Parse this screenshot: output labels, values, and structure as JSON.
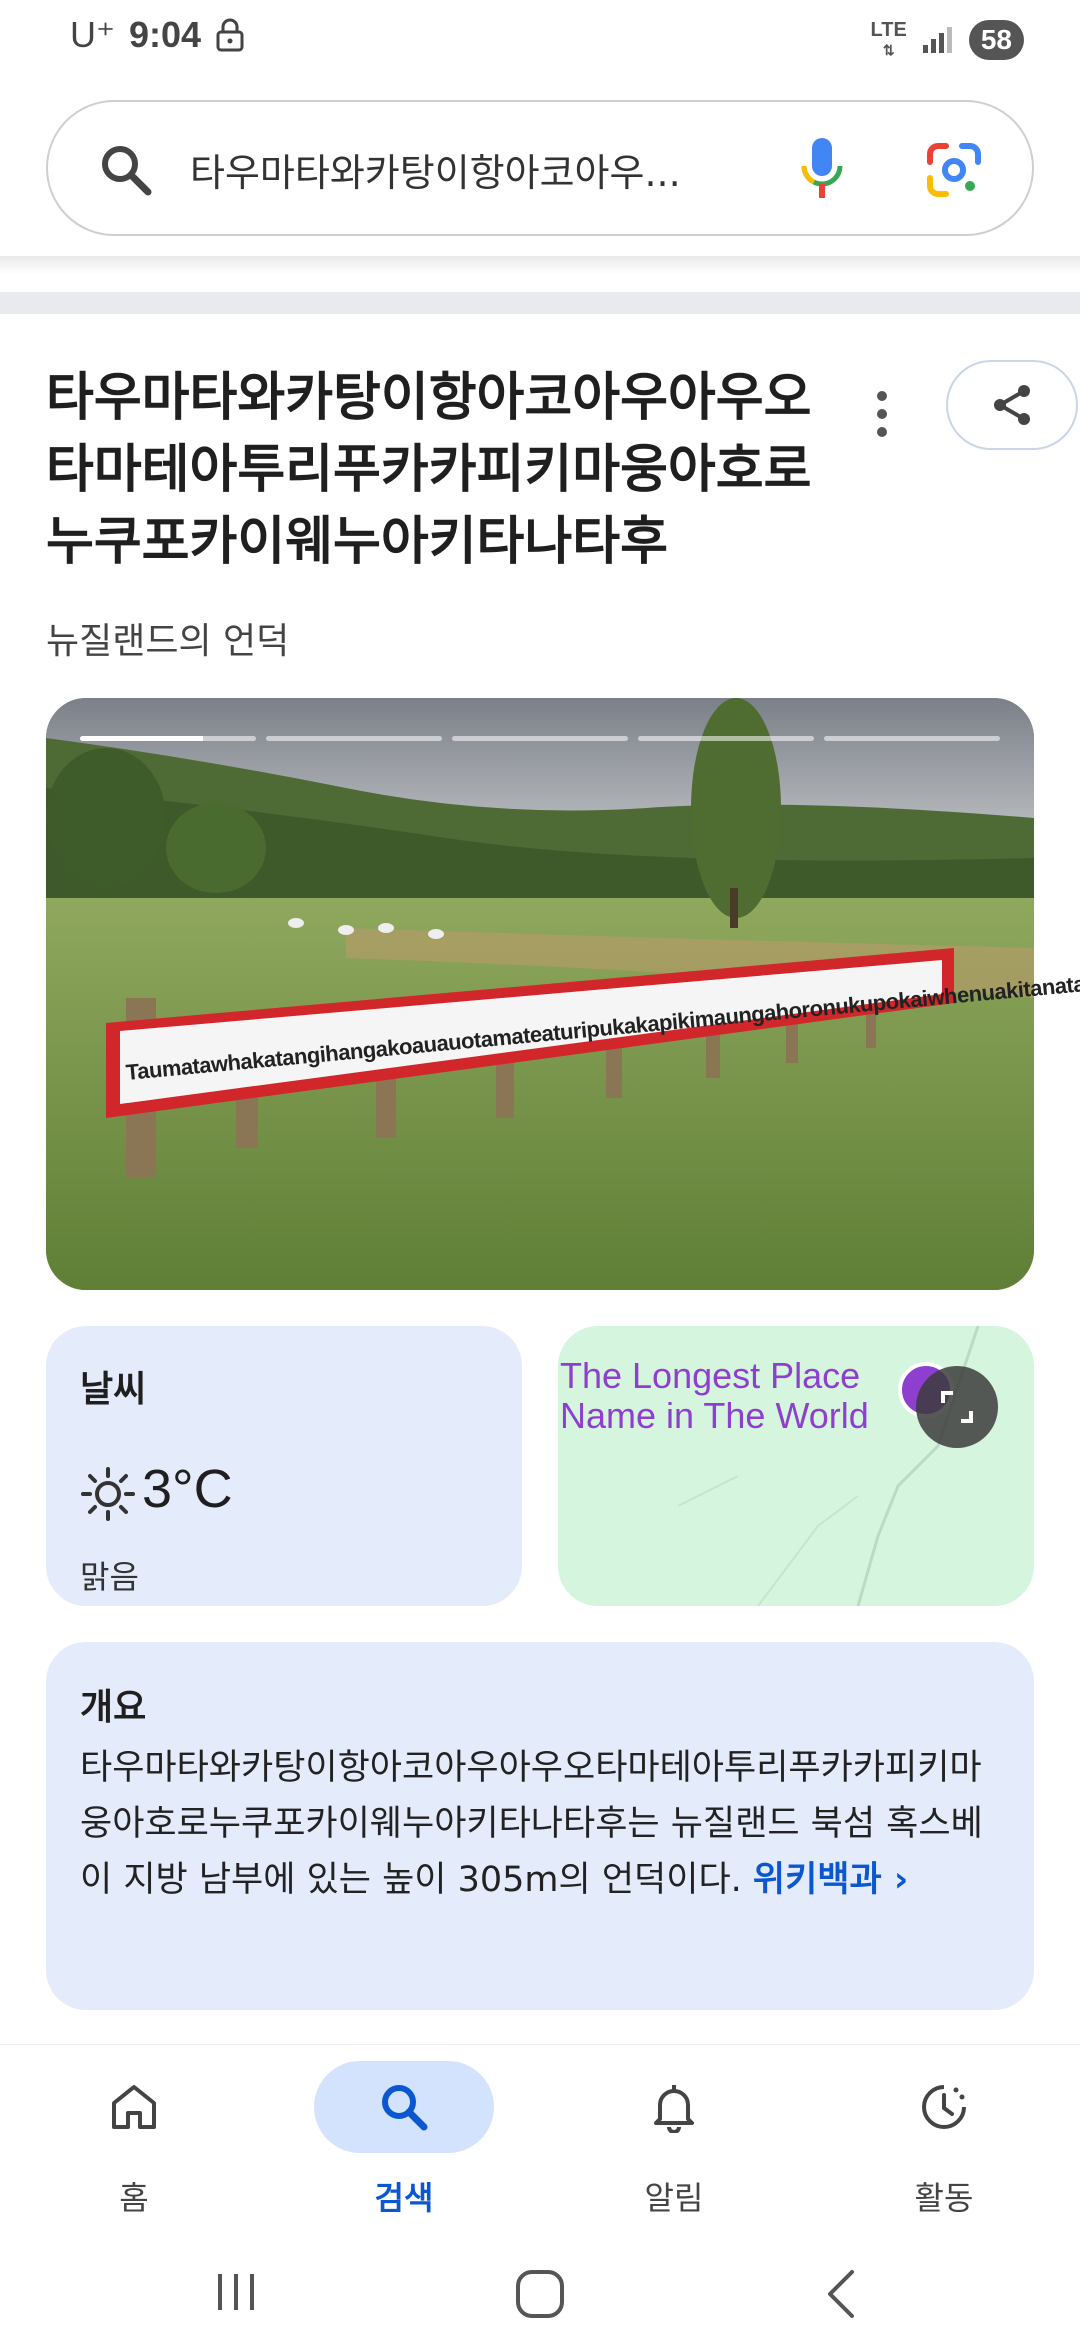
{
  "status_bar": {
    "carrier": "U⁺",
    "time": "9:04",
    "network": "LTE",
    "battery": "58"
  },
  "search": {
    "query": "타우마타와카탕이항아코아우..."
  },
  "knowledge_panel": {
    "title": "타우마타와카탕이항아코아우아우오타마테아투리푸카카피키마웅아호로누쿠포카이웨누아키타나타후",
    "subtitle": "뉴질랜드의 언덕",
    "image_sign_text": "Taumatawhakatangihangakoauauotamateaturipukakapikimaungahoronukupokaiwhenuakitanatahu",
    "weather": {
      "label": "날씨",
      "temperature": "3°C",
      "condition": "맑음"
    },
    "map": {
      "place_label": "The Longest Place Name in The World"
    },
    "overview": {
      "label": "개요",
      "text": "타우마타와카탕이항아코아우아우오타마테아투리푸카카피키마웅아호로누쿠포카이웨누아키타나타후는 뉴질랜드 북섬 혹스베이 지방 남부에 있는 높이 305m의 언덕이다. ",
      "source_link": "위키백과 ›"
    }
  },
  "bottom_nav": {
    "items": [
      {
        "label": "홈"
      },
      {
        "label": "검색"
      },
      {
        "label": "알림"
      },
      {
        "label": "활동"
      }
    ]
  },
  "colors": {
    "accent": "#0b57d0",
    "card_bg": "#e4ebfb",
    "map_bg": "#d6f5df",
    "map_pin": "#8e3fcf"
  }
}
